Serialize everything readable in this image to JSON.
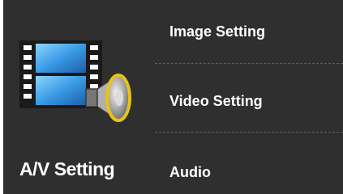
{
  "sidebar": {
    "title": "A/V Setting",
    "icon": "film-speaker-icon"
  },
  "menu": {
    "items": [
      {
        "label": "Image Setting"
      },
      {
        "label": "Video Setting"
      },
      {
        "label": "Audio"
      }
    ]
  },
  "colors": {
    "background": "#2f2f2f",
    "text": "#ffffff",
    "divider": "#5e5e5e",
    "film_blue": "#2f8fd8",
    "speaker_yellow": "#e8c21a"
  }
}
